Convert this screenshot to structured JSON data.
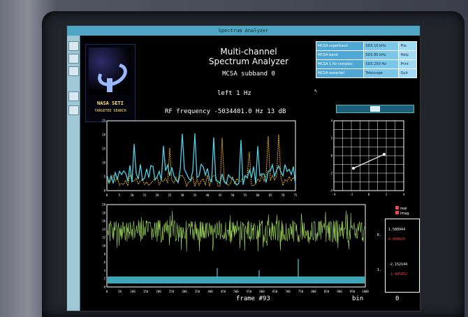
{
  "window": {
    "title": "Spectrum Analyzer"
  },
  "logo": {
    "name": "NASA SETI",
    "subtitle": "TARGETED SEARCH"
  },
  "app": {
    "title_line1": "Multi-channel",
    "title_line2": "Spectrum Analyzer",
    "subband": "MCSA subband 0",
    "resolution": "left 1 Hz",
    "rf_frequency": "RF frequency -5034401.0 Hz  13 dB"
  },
  "info_table": [
    [
      "MCSA superband",
      "SDS 10 kHz",
      "File"
    ],
    [
      "MCSA band",
      "SDS 80 kHz",
      "Help"
    ],
    [
      "MCSA 1 Hz complex",
      "SDS 250 Hz",
      "Print"
    ],
    [
      "MCSA waterfall",
      "Telescope",
      "Quit"
    ]
  ],
  "top_plot": {
    "y_ticks": [
      "25",
      "20",
      "15",
      "10",
      "5",
      "0"
    ],
    "x_ticks": [
      "0",
      "5",
      "10",
      "15",
      "20",
      "25",
      "30",
      "35",
      "40",
      "45",
      "50",
      "55",
      "60",
      "65",
      "70",
      "75"
    ],
    "colors": {
      "series_a": "#4fd0e6",
      "series_b": "#e8b020"
    }
  },
  "grid_plot": {
    "x_ticks": [
      "-4",
      "-2",
      "0",
      "2",
      "4"
    ],
    "y_ticks": [
      "4",
      "2",
      "0",
      "-2",
      "-4"
    ]
  },
  "bottom_plot": {
    "y_ticks": [
      "20",
      "18",
      "16",
      "14",
      "12",
      "10",
      "8",
      "6",
      "4",
      "2",
      "0"
    ],
    "x_ticks": [
      "0",
      "50",
      "100",
      "150",
      "200",
      "250",
      "300",
      "350",
      "400",
      "450",
      "500",
      "550",
      "600",
      "650",
      "700",
      "750",
      "800",
      "850",
      "900",
      "950",
      "1000"
    ],
    "colors": {
      "noise": "#a5e060",
      "baseline": "#4fd0e6"
    },
    "frame": "frame #93",
    "axis": "bin",
    "value": "0"
  },
  "legend": {
    "item1": "real",
    "item2": "imag",
    "color1": "#e64b4b",
    "color2": "#e64b4b"
  },
  "values_panel": {
    "label_r": "R.",
    "label_i": "I.",
    "v1": "1.580944",
    "v2": "0.000025",
    "v3": "-2.152144",
    "v4": "-1.495952"
  }
}
